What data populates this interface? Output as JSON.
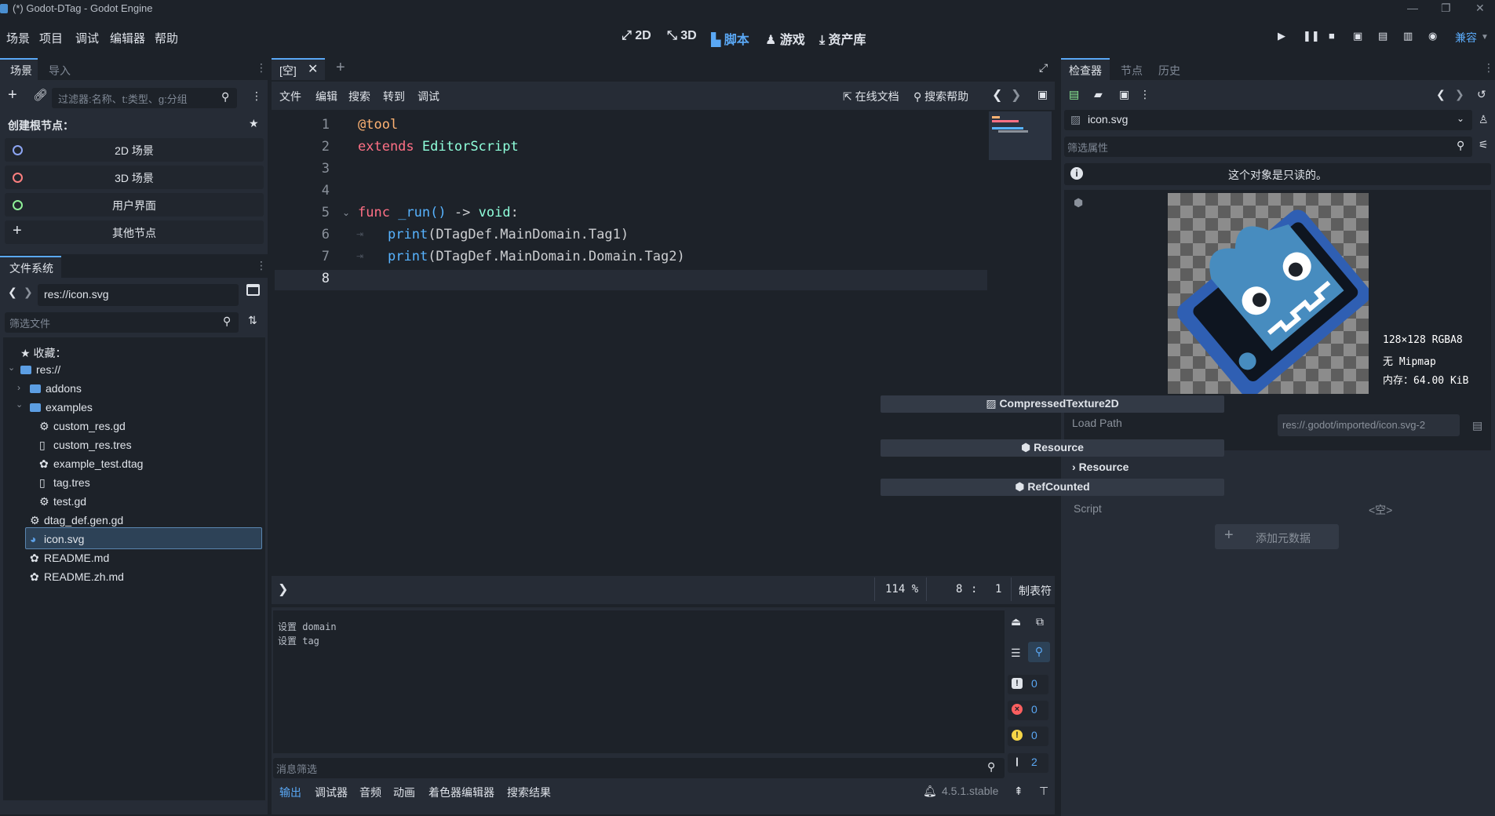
{
  "window": {
    "title": "(*) Godot-DTag - Godot Engine"
  },
  "menu": [
    "场景",
    "项目",
    "调试",
    "编辑器",
    "帮助"
  ],
  "workspaces": [
    {
      "label": "2D",
      "icon": "2d-icon"
    },
    {
      "label": "3D",
      "icon": "3d-icon"
    },
    {
      "label": "脚本",
      "icon": "script-icon"
    },
    {
      "label": "游戏",
      "icon": "game-icon"
    },
    {
      "label": "资产库",
      "icon": "assetlib-icon"
    }
  ],
  "renderer": "兼容",
  "scene_dock": {
    "tabs": [
      "场景",
      "导入"
    ],
    "filter_placeholder": "过滤器:名称、t:类型、g:分组",
    "create_root_label": "创建根节点：",
    "root_options": [
      {
        "label": "2D 场景",
        "color": "#8da5f3"
      },
      {
        "label": "3D 场景",
        "color": "#fc7f7f"
      },
      {
        "label": "用户界面",
        "color": "#8eef97"
      },
      {
        "label": "其他节点",
        "color": "#e0e0e0"
      }
    ]
  },
  "filesystem": {
    "title": "文件系统",
    "path": "res://icon.svg",
    "filter_placeholder": "筛选文件",
    "favorites_label": "收藏：",
    "items": [
      {
        "label": "res://",
        "type": "folder"
      },
      {
        "label": "addons",
        "type": "folder"
      },
      {
        "label": "examples",
        "type": "folder"
      },
      {
        "label": "custom_res.gd",
        "type": "script"
      },
      {
        "label": "custom_res.tres",
        "type": "resource"
      },
      {
        "label": "example_test.dtag",
        "type": "file"
      },
      {
        "label": "tag.tres",
        "type": "resource"
      },
      {
        "label": "test.gd",
        "type": "script"
      },
      {
        "label": "dtag_def.gen.gd",
        "type": "script"
      },
      {
        "label": "icon.svg",
        "type": "image"
      },
      {
        "label": "README.md",
        "type": "file"
      },
      {
        "label": "README.zh.md",
        "type": "file"
      }
    ]
  },
  "script_editor": {
    "tab_label": "[空]",
    "menu": [
      "文件",
      "编辑",
      "搜索",
      "转到",
      "调试"
    ],
    "online_docs": "在线文档",
    "search_help": "搜索帮助",
    "line_numbers": [
      "1",
      "2",
      "3",
      "4",
      "5",
      "6",
      "7",
      "8"
    ],
    "code": {
      "l1": "@tool",
      "l2_kw": "extends",
      "l2_ty": "EditorScript",
      "l5_kw": "func",
      "l5_fn": "_run()",
      "l5_arrow": "->",
      "l5_void": "void",
      "l5_colon": ":",
      "l6_fn": "print",
      "l6_args": "(DTagDef.MainDomain.Tag1)",
      "l7_fn": "print",
      "l7_args": "(DTagDef.MainDomain.Domain.Tag2)"
    },
    "zoom": "114 %",
    "cursor_line": "8",
    "cursor_sep": ":",
    "cursor_col": "1",
    "indent_mode": "制表符"
  },
  "output": {
    "lines": [
      "设置 domain",
      "设置 tag"
    ],
    "filter_placeholder": "消息筛选",
    "counts": {
      "errors": "0",
      "errors2": "0",
      "warnings": "0",
      "messages": "2"
    }
  },
  "bottom_tabs": [
    "输出",
    "调试器",
    "音频",
    "动画",
    "着色器编辑器",
    "搜索结果"
  ],
  "version": "4.5.1.stable",
  "inspector": {
    "tabs": [
      "检查器",
      "节点",
      "历史"
    ],
    "resource_name": "icon.svg",
    "filter_placeholder": "筛选属性",
    "readonly_msg": "这个对象是只读的。",
    "texture_info": [
      "128×128 RGBA8",
      "无 Mipmap",
      "内存：64.00 KiB"
    ],
    "sections": {
      "compressed": "CompressedTexture2D",
      "resource": "Resource",
      "resource_group": "Resource",
      "refcounted": "RefCounted"
    },
    "load_path_label": "Load Path",
    "load_path_value": "res://.godot/imported/icon.svg-2",
    "script_label": "Script",
    "script_value": "<空>",
    "add_metadata": "添加元数据"
  }
}
